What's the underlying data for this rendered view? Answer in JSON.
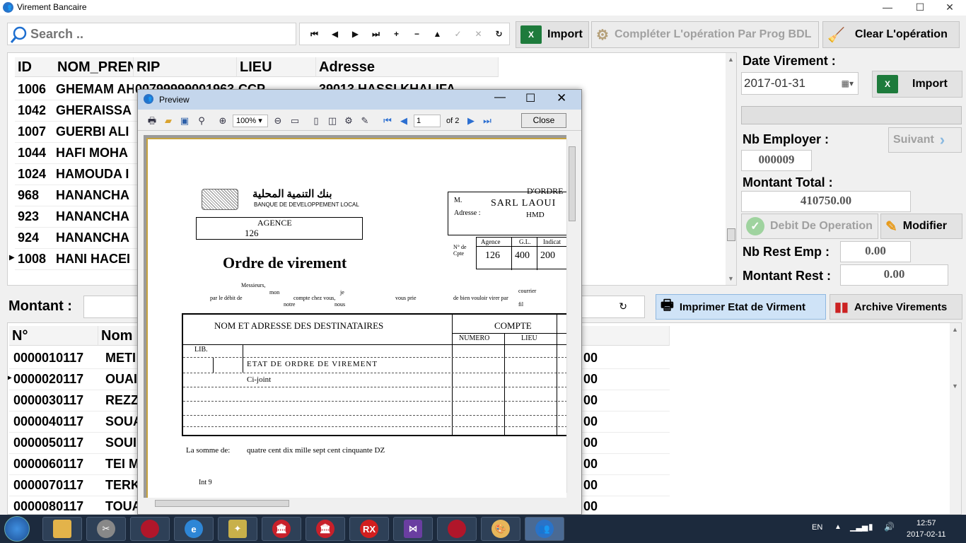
{
  "window": {
    "title": "Virement Bancaire",
    "min": "—",
    "max": "☐",
    "close": "✕"
  },
  "search": {
    "placeholder": "Search .."
  },
  "nav": [
    "⏮",
    "◀",
    "▶",
    "⏭",
    "+",
    "−",
    "▲",
    "✓",
    "✕",
    "↻"
  ],
  "toolbar": {
    "import_label": "Import",
    "complete_label": "Compléter L'opération Par Prog BDL",
    "clear_label": "Clear L'opération"
  },
  "grid1": {
    "columns": [
      "ID",
      "NOM_PRENOM",
      "RIP",
      "LIEU",
      "Adresse"
    ],
    "rows": [
      {
        "id": "1006",
        "name": "GHEMAM AHMED",
        "rip": "00799999001963",
        "lieu": "CCP",
        "adresse": "39013 HASSI KHALIFA"
      },
      {
        "id": "1042",
        "name": "GHERAISSA",
        "rip": "",
        "lieu": "",
        "adresse": ""
      },
      {
        "id": "1007",
        "name": "GUERBI ALI",
        "rip": "",
        "lieu": "",
        "adresse": ""
      },
      {
        "id": "1044",
        "name": "HAFI MOHA",
        "rip": "",
        "lieu": "",
        "adresse": ""
      },
      {
        "id": "1024",
        "name": "HAMOUDA I",
        "rip": "",
        "lieu": "",
        "adresse": ""
      },
      {
        "id": "968",
        "name": "HANANCHA",
        "rip": "",
        "lieu": "",
        "adresse": ""
      },
      {
        "id": "923",
        "name": "HANANCHA",
        "rip": "",
        "lieu": "",
        "adresse": ""
      },
      {
        "id": "924",
        "name": "HANANCHA",
        "rip": "",
        "lieu": "",
        "adresse": ""
      },
      {
        "id": "1008",
        "name": "HANI HACEI",
        "rip": "",
        "lieu": "",
        "adresse": ""
      }
    ]
  },
  "right": {
    "date_label": "Date Virement :",
    "date_value": "2017-01-31",
    "import_label": "Import",
    "nb_employer_label": "Nb Employer :",
    "suivant_label": "Suivant",
    "nb_employer_value": "000009",
    "montant_total_label": "Montant Total :",
    "montant_total_value": "410750.00",
    "debit_label": "Debit De Operation",
    "modifier_label": "Modifier",
    "nb_rest_label": "Nb Rest Emp :",
    "nb_rest_value": "0.00",
    "montant_rest_label": "Montant Rest :",
    "montant_rest_value": "0.00"
  },
  "montant_label": "Montant :",
  "print_label": "Imprimer Etat de Virment",
  "archive_label": "Archive Virements",
  "grid2": {
    "columns": [
      "N°",
      "Nom"
    ],
    "rows": [
      {
        "n": "0000010117",
        "nom": "METI",
        "amt": "00"
      },
      {
        "n": "0000020117",
        "nom": "OUAI",
        "amt": "00"
      },
      {
        "n": "0000030117",
        "nom": "REZZ",
        "amt": "00"
      },
      {
        "n": "0000040117",
        "nom": "SOUA",
        "amt": "00"
      },
      {
        "n": "0000050117",
        "nom": "SOUI",
        "amt": "00"
      },
      {
        "n": "0000060117",
        "nom": "TEI M",
        "amt": "00"
      },
      {
        "n": "0000070117",
        "nom": "TERK",
        "amt": "00"
      },
      {
        "n": "0000080117",
        "nom": "TOUA",
        "amt": "00"
      }
    ]
  },
  "preview": {
    "title": "Preview",
    "zoom": "100%",
    "page": "1",
    "of_pages": "of 2",
    "close_label": "Close",
    "bank_ar": "بنك التنمية المحلية",
    "bank_fr": "BANQUE DE DEVELOPPEMENT LOCAL",
    "agence_label": "AGENCE",
    "agence_value": "126",
    "ordre_label": "D'ORDRE",
    "m_label": "M.",
    "m_value": "SARL LAOUI",
    "adresse_label": "Adresse :",
    "adresse_value": "HMD",
    "cpte_label": "N° de Cpte",
    "cpte_heads": [
      "Agence",
      "G.L.",
      "Indicat"
    ],
    "cpte_values": [
      "126",
      "400",
      "200"
    ],
    "doc_title": "Ordre de virement",
    "msg_line1": "Messieurs,",
    "msg_mon": "mon",
    "msg_je": "je",
    "msg_courrier": "courrier",
    "msg_debit": "par le débit de",
    "msg_compte": "compte chez vous,",
    "msg_prie": "vous prie",
    "msg_bien": "de bien vouloir virer par",
    "msg_notre": "notre",
    "msg_nous": "nous",
    "msg_fil": "fil",
    "tbl_head1": "NOM ET ADRESSE DES DESTINATAIRES",
    "tbl_head2": "COMPTE",
    "tbl_numero": "NUMERO",
    "tbl_lieu": "LIEU",
    "tbl_lib": "LIB.",
    "tbl_etat": "ETAT DE ORDRE DE VIREMENT",
    "tbl_cijoint": "Ci-joint",
    "somme_label": "La somme de:",
    "somme_value": "quatre cent dix mille sept cent cinquante  DZ",
    "int9": "Int 9"
  },
  "tray": {
    "lang": "EN",
    "time": "12:57",
    "date": "2017-02-11"
  }
}
